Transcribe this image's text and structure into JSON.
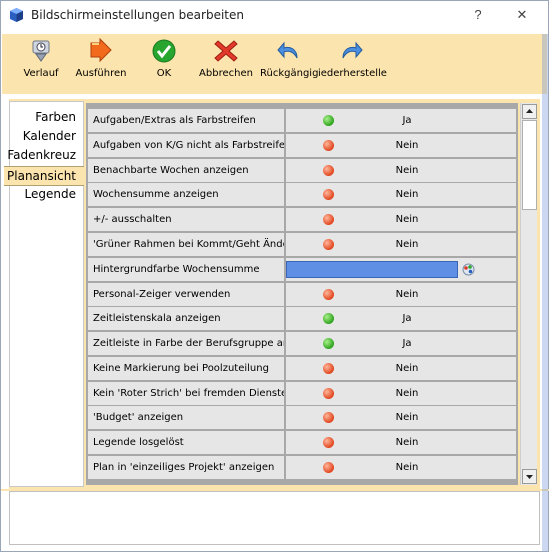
{
  "window": {
    "title": "Bildschirmeinstellungen bearbeiten",
    "help_glyph": "?",
    "close_glyph": "✕"
  },
  "toolbar": {
    "items": [
      {
        "label": "Verlauf",
        "icon": "history-icon"
      },
      {
        "label": "Ausführen",
        "icon": "execute-icon"
      },
      {
        "label": "OK",
        "icon": "ok-check-icon"
      },
      {
        "label": "Abbrechen",
        "icon": "cancel-x-icon"
      },
      {
        "label": "Rückgängig",
        "icon": "undo-icon"
      },
      {
        "label": "iederherstelle",
        "icon": "redo-icon"
      }
    ]
  },
  "nav": {
    "items": [
      {
        "label": "Farben"
      },
      {
        "label": "Kalender"
      },
      {
        "label": "Fadenkreuz"
      },
      {
        "label": "Planansicht",
        "active": true
      },
      {
        "label": "Legende"
      }
    ]
  },
  "settings": {
    "rows": [
      {
        "label": "Aufgaben/Extras als Farbstreifen",
        "status": "green",
        "value": "Ja"
      },
      {
        "label": "Aufgaben von K/G nicht als Farbstreifen",
        "status": "red",
        "value": "Nein"
      },
      {
        "label": "Benachbarte Wochen anzeigen",
        "status": "red",
        "value": "Nein"
      },
      {
        "label": "Wochensumme anzeigen",
        "status": "red",
        "value": "Nein"
      },
      {
        "label": "+/- ausschalten",
        "status": "red",
        "value": "Nein"
      },
      {
        "label": "'Grüner Rahmen bei Kommt/Geht Änderu",
        "status": "red",
        "value": "Nein"
      },
      {
        "label": "Hintergrundfarbe Wochensumme",
        "status": "color",
        "value": ""
      },
      {
        "label": "Personal-Zeiger verwenden",
        "status": "red",
        "value": "Nein"
      },
      {
        "label": "Zeitleistenskala anzeigen",
        "status": "green",
        "value": "Ja"
      },
      {
        "label": "Zeitleiste in Farbe der Berufsgruppe anz",
        "status": "green",
        "value": "Ja"
      },
      {
        "label": "Keine Markierung bei Poolzuteilung",
        "status": "red",
        "value": "Nein"
      },
      {
        "label": "Kein 'Roter Strich' bei fremden Diensten",
        "status": "red",
        "value": "Nein"
      },
      {
        "label": "'Budget' anzeigen",
        "status": "red",
        "value": "Nein"
      },
      {
        "label": "Legende losgelöst",
        "status": "red",
        "value": "Nein"
      },
      {
        "label": "Plan in 'einzeiliges Projekt' anzeigen",
        "status": "red",
        "value": "Nein"
      }
    ],
    "swatch_color": "#5f8fe4"
  },
  "colors": {
    "toolbar_bg": "#fbe4ad",
    "green_status": "#2ea31d",
    "red_status": "#e1461e"
  }
}
